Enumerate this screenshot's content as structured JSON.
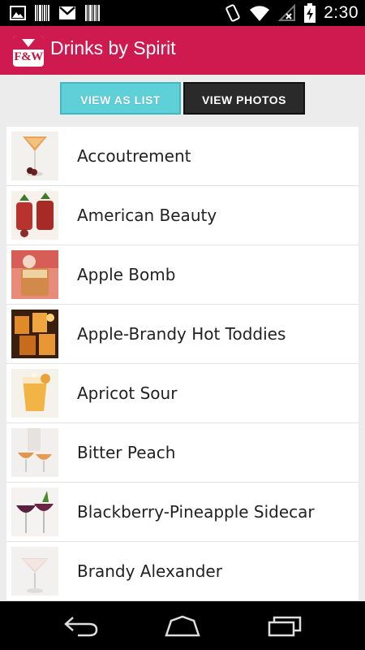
{
  "status_bar": {
    "time": "2:30",
    "left_icons": [
      "gallery-icon",
      "barcode-icon",
      "gmail-icon",
      "barcode-icon"
    ],
    "right_icons": [
      "vibrate-icon",
      "wifi-icon",
      "no-signal-icon",
      "battery-charging-icon"
    ]
  },
  "action_bar": {
    "logo_text": "F&W",
    "title": "Drinks by Spirit",
    "color": "#cf1a4f"
  },
  "view_switch": {
    "list_label": "VIEW AS LIST",
    "photos_label": "VIEW PHOTOS",
    "selected": "list",
    "list_color": "#5fd0d8",
    "photos_color": "#2a2a2a"
  },
  "drinks": [
    {
      "name": "Accoutrement",
      "thumb": "martini-amber"
    },
    {
      "name": "American Beauty",
      "thumb": "red-glasses"
    },
    {
      "name": "Apple Bomb",
      "thumb": "rocks-amber"
    },
    {
      "name": "Apple-Brandy Hot Toddies",
      "thumb": "hot-toddies"
    },
    {
      "name": "Apricot Sour",
      "thumb": "sour-glass"
    },
    {
      "name": "Bitter Peach",
      "thumb": "peach-glasses"
    },
    {
      "name": "Blackberry-Pineapple Sidecar",
      "thumb": "purple-coupes"
    },
    {
      "name": "Brandy Alexander",
      "thumb": "cream-martini"
    }
  ],
  "nav_bar": {
    "buttons": [
      "back-icon",
      "home-icon",
      "recents-icon"
    ]
  }
}
